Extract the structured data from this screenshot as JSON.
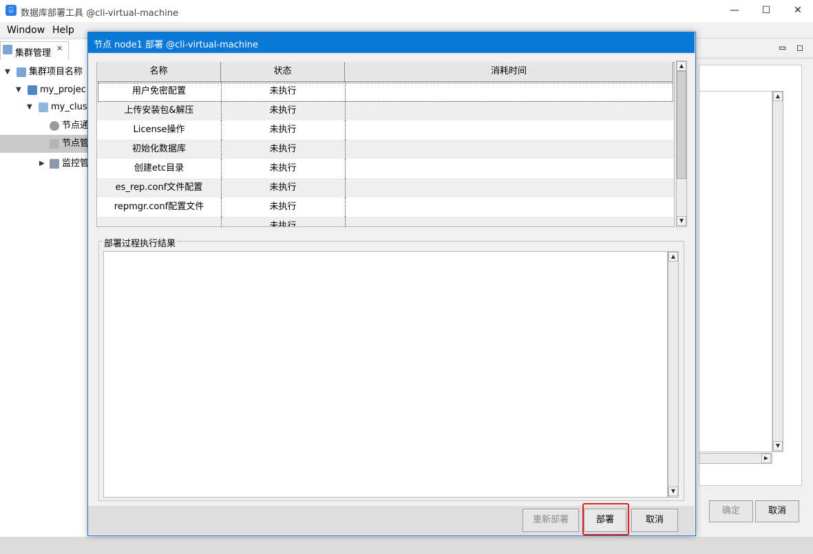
{
  "window": {
    "title": "数据库部署工具 @cli-virtual-machine",
    "minimize": "—",
    "maximize": "☐",
    "close": "✕"
  },
  "menu": [
    "Window",
    "Help"
  ],
  "left_view": {
    "tab_label": "集群管理",
    "tab_close": "✕",
    "tree": [
      {
        "label": "集群项目名称"
      },
      {
        "label": "my_projec"
      },
      {
        "label": "my_clus"
      },
      {
        "label": "节点通"
      },
      {
        "label": "节点管"
      },
      {
        "label": "监控管"
      }
    ]
  },
  "background_buttons": {
    "confirm": "确定",
    "cancel": "取消"
  },
  "dialog": {
    "title": "节点 node1 部署 @cli-virtual-machine",
    "columns": [
      "名称",
      "状态",
      "消耗时间"
    ],
    "rows": [
      {
        "name": "用户免密配置",
        "status": "未执行",
        "time": ""
      },
      {
        "name": "上传安装包&解压",
        "status": "未执行",
        "time": ""
      },
      {
        "name": "License操作",
        "status": "未执行",
        "time": ""
      },
      {
        "name": "初始化数据库",
        "status": "未执行",
        "time": ""
      },
      {
        "name": "创建etc目录",
        "status": "未执行",
        "time": ""
      },
      {
        "name": "es_rep.conf文件配置",
        "status": "未执行",
        "time": ""
      },
      {
        "name": "repmgr.conf配置文件",
        "status": "未执行",
        "time": ""
      },
      {
        "name": "",
        "status": "未执行",
        "time": ""
      }
    ],
    "result_group_label": "部署过程执行结果",
    "buttons": {
      "redeploy": "重新部署",
      "deploy": "部署",
      "cancel": "取消"
    }
  }
}
